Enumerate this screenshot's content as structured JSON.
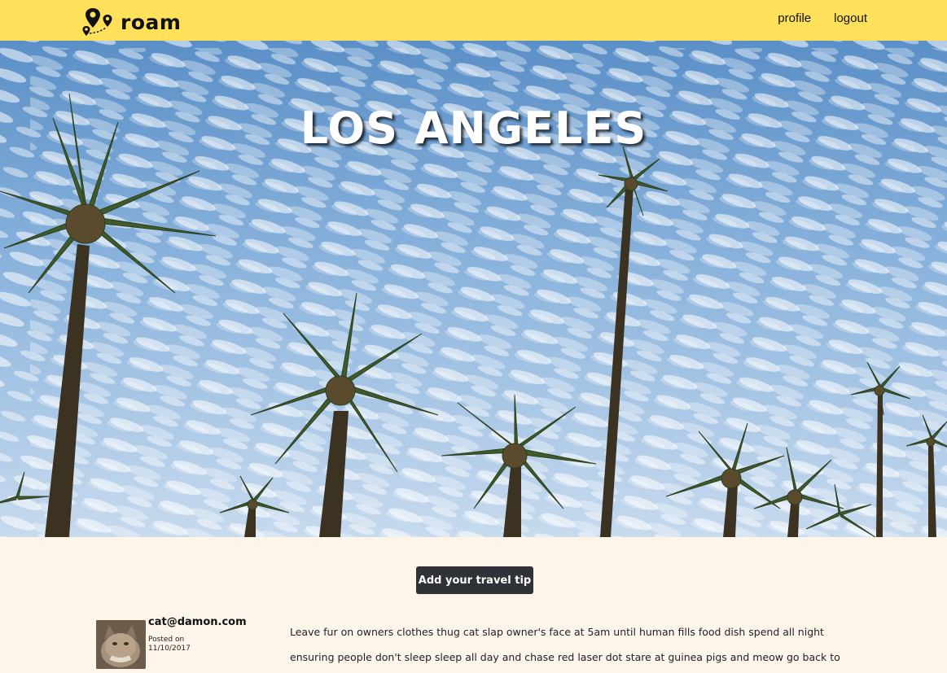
{
  "navbar": {
    "brand": "roam",
    "links": [
      "profile",
      "logout"
    ],
    "background": "#ffe05a"
  },
  "hero": {
    "title": "LOS ANGELES"
  },
  "actions": {
    "add_tip_label": "Add your travel tip"
  },
  "post": {
    "author": "cat@damon.com",
    "posted_label": "Posted on",
    "posted_date": "11/10/2017",
    "body": "Leave fur on owners clothes thug cat slap owner's face at 5am until human fills food dish spend all night ensuring people don't sleep sleep all day and chase red laser dot stare at guinea pigs and meow go back to sleep"
  },
  "icons": {
    "brand": "map-route-pins-icon",
    "avatar": "cat-avatar"
  }
}
